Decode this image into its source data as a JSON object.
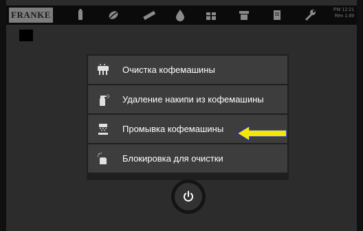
{
  "header": {
    "logo_text": "FRANKE",
    "clock_line1": "PM 12:21",
    "clock_line2": "Rev 1.69",
    "icons": [
      "tool-icon",
      "beans-icon",
      "ruler-icon",
      "drop-icon",
      "gift-icon",
      "cup-icon",
      "document-icon",
      "wrench-icon"
    ]
  },
  "menu": {
    "items": [
      {
        "label": "Очистка кофемашины",
        "icon": "cleaning-icon"
      },
      {
        "label": "Удаление накипи из кофемашины",
        "icon": "descale-spray-icon"
      },
      {
        "label": "Промывка кофемашины",
        "icon": "rinse-icon"
      },
      {
        "label": "Блокировка для очистки",
        "icon": "cleaning-lock-icon"
      }
    ]
  },
  "highlight_arrow_color": "#f5e60a",
  "power_button": {
    "icon": "power-icon"
  }
}
